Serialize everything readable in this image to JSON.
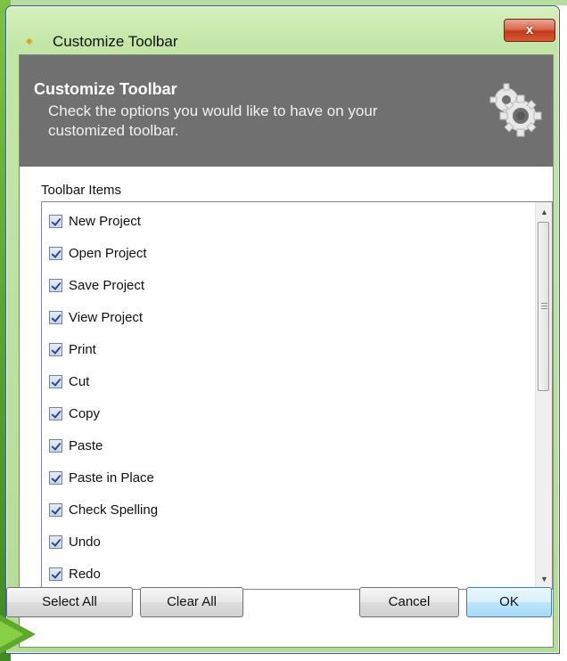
{
  "window": {
    "title": "Customize Toolbar",
    "close_label": "x"
  },
  "header": {
    "title": "Customize Toolbar",
    "description": "Check the options you would like to have on your customized toolbar."
  },
  "list": {
    "label": "Toolbar Items",
    "items": [
      {
        "label": "New Project",
        "checked": true
      },
      {
        "label": "Open Project",
        "checked": true
      },
      {
        "label": "Save Project",
        "checked": true
      },
      {
        "label": "View Project",
        "checked": true
      },
      {
        "label": "Print",
        "checked": true
      },
      {
        "label": "Cut",
        "checked": true
      },
      {
        "label": "Copy",
        "checked": true
      },
      {
        "label": "Paste",
        "checked": true
      },
      {
        "label": "Paste in Place",
        "checked": true
      },
      {
        "label": "Check Spelling",
        "checked": true
      },
      {
        "label": "Undo",
        "checked": true
      },
      {
        "label": "Redo",
        "checked": true
      }
    ]
  },
  "buttons": {
    "select_all": "Select All",
    "clear_all": "Clear All",
    "cancel": "Cancel",
    "ok": "OK"
  },
  "colors": {
    "header_band": "#707070",
    "frame_green": "#b5dc95",
    "close_red": "#c2391c",
    "arrow_green": "#5ea82b"
  },
  "icons": [
    "app-icon",
    "close-icon",
    "gear-icon",
    "scroll-up-icon",
    "scroll-down-icon",
    "checkbox-checked-icon",
    "pointer-arrow-icon"
  ]
}
